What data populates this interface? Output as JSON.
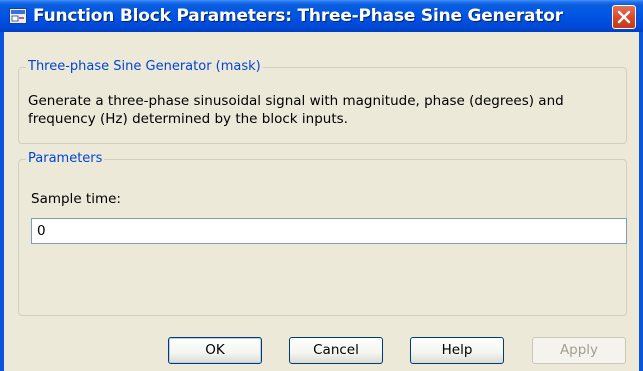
{
  "window": {
    "title": "Function Block Parameters: Three-Phase Sine Generator"
  },
  "mask_group": {
    "title": "Three-phase Sine Generator (mask)",
    "description": "Generate a three-phase sinusoidal signal with magnitude, phase (degrees) and frequency (Hz) determined by the block inputs."
  },
  "parameters_group": {
    "title": "Parameters",
    "sample_time_label": "Sample time:",
    "sample_time_value": "0"
  },
  "buttons": {
    "ok": "OK",
    "cancel": "Cancel",
    "help": "Help",
    "apply": "Apply"
  },
  "colors": {
    "titlebar": "#0055e5",
    "group_title": "#0046d5",
    "dialog_bg": "#ece9d8",
    "close": "#d84a2a"
  },
  "icons": {
    "app": "simulink-block-icon",
    "close": "close-icon"
  }
}
